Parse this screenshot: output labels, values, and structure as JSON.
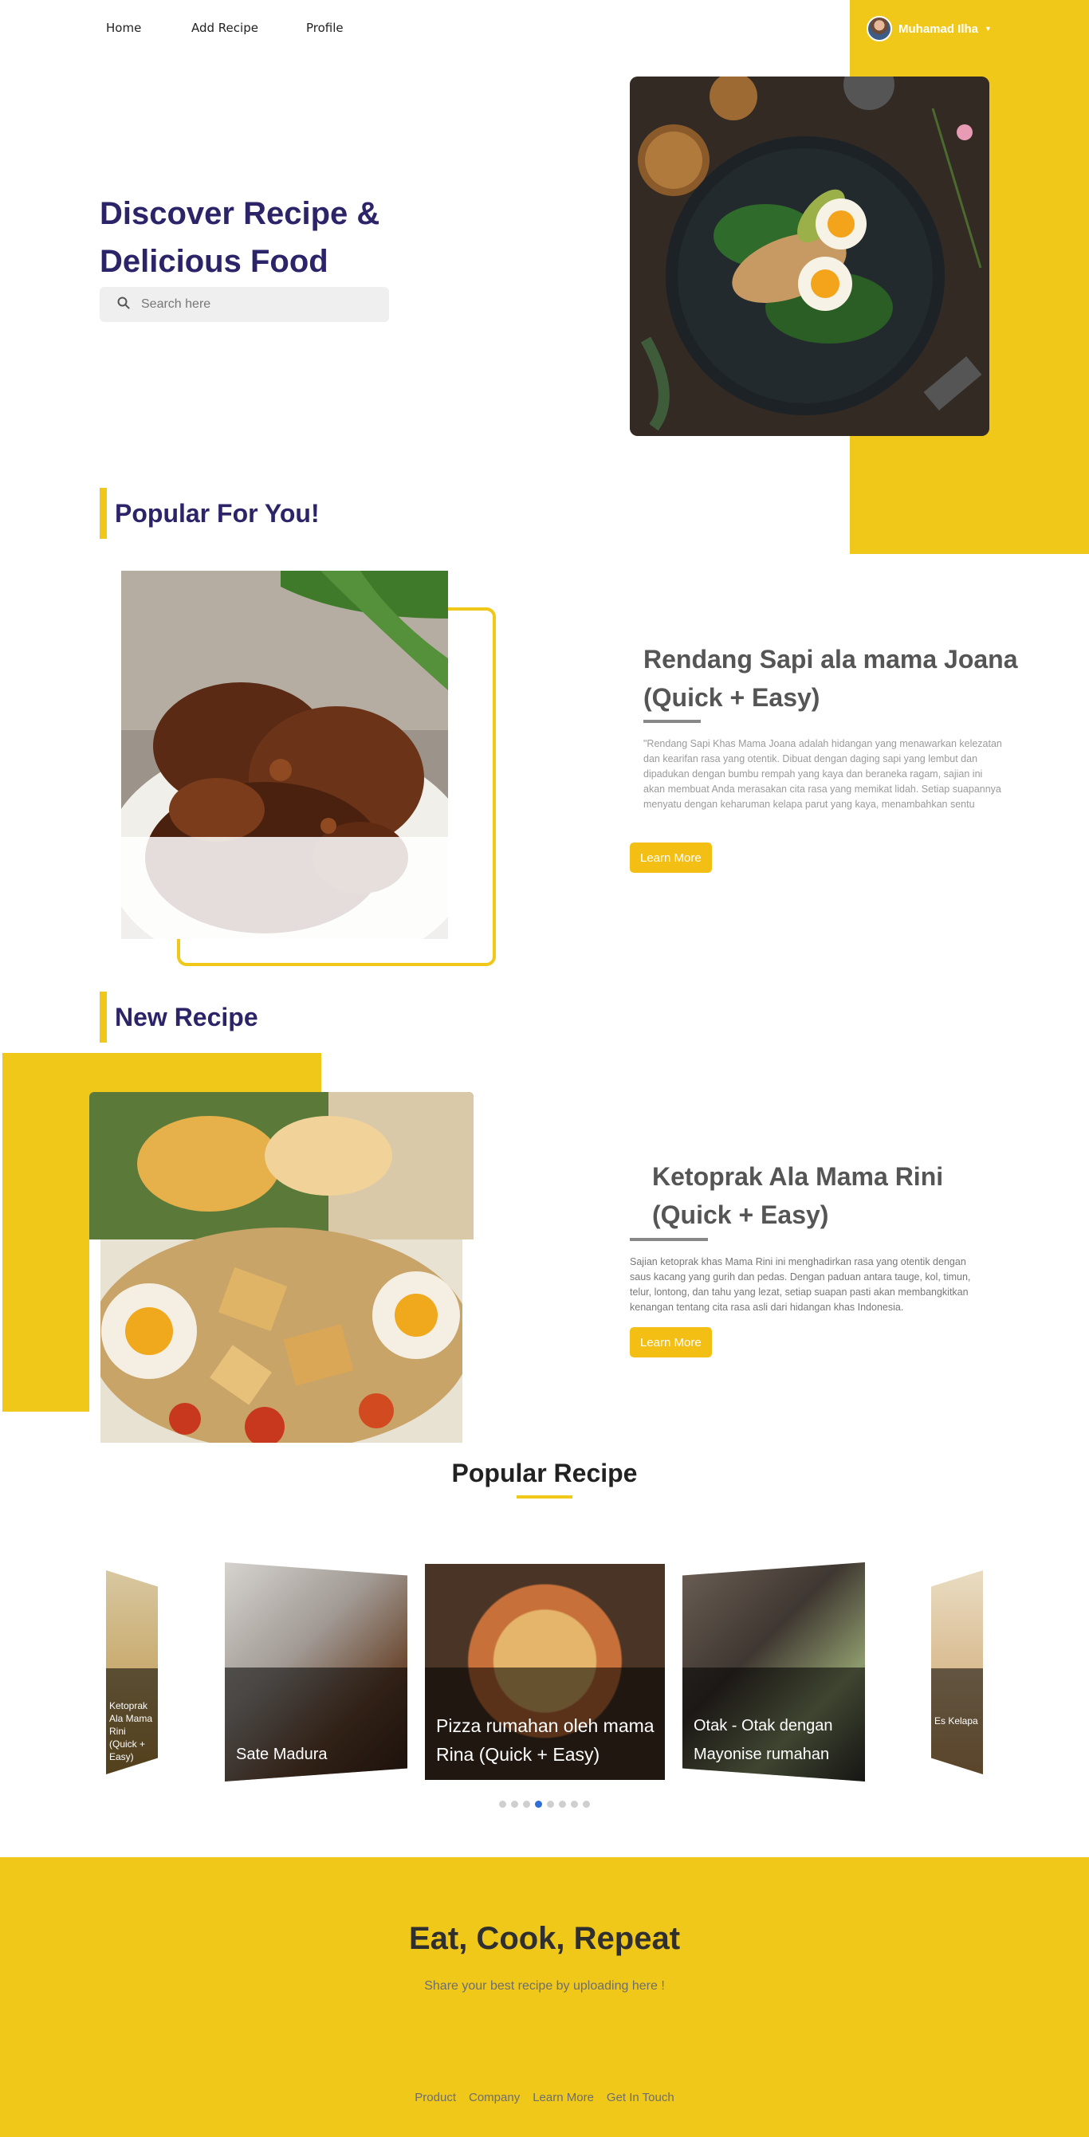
{
  "nav": {
    "links": [
      "Home",
      "Add Recipe",
      "Profile"
    ],
    "user_name": "Muhamad Ilha"
  },
  "hero": {
    "title": "Discover Recipe & Delicious Food",
    "search_placeholder": "Search here"
  },
  "popular_for_you": {
    "heading": "Popular For You!",
    "title": "Rendang Sapi ala mama Joana (Quick + Easy)",
    "description": "\"Rendang Sapi Khas Mama Joana adalah hidangan yang menawarkan kelezatan dan kearifan rasa yang otentik. Dibuat dengan daging sapi yang lembut dan dipadukan dengan bumbu rempah yang kaya dan beraneka ragam, sajian ini akan membuat Anda merasakan cita rasa yang memikat lidah. Setiap suapannya menyatu dengan keharuman kelapa parut yang kaya, menambahkan sentu",
    "button": "Learn More"
  },
  "new_recipe": {
    "heading": "New Recipe",
    "title": "Ketoprak Ala Mama Rini (Quick + Easy)",
    "description": "Sajian ketoprak khas Mama Rini ini menghadirkan rasa yang otentik dengan saus kacang yang gurih dan pedas. Dengan paduan antara tauge, kol, timun, telur, lontong, dan tahu yang lezat, setiap suapan pasti akan membangkitkan kenangan tentang cita rasa asli dari hidangan khas Indonesia.",
    "button": "Learn More"
  },
  "popular_recipe": {
    "heading": "Popular Recipe",
    "slides": [
      {
        "caption": "Ketoprak Ala Mama Rini (Quick + Easy)"
      },
      {
        "caption": "Sate Madura"
      },
      {
        "caption": "Pizza rumahan oleh mama Rina (Quick + Easy)"
      },
      {
        "caption": "Otak - Otak dengan Mayonise rumahan"
      },
      {
        "caption": "Es Kelapa"
      }
    ],
    "dots_total": 8,
    "dots_active": 4
  },
  "footer": {
    "title": "Eat, Cook, Repeat",
    "subtitle": "Share your best recipe by uploading here !",
    "links": [
      "Product",
      "Company",
      "Learn More",
      "Get In Touch"
    ]
  }
}
